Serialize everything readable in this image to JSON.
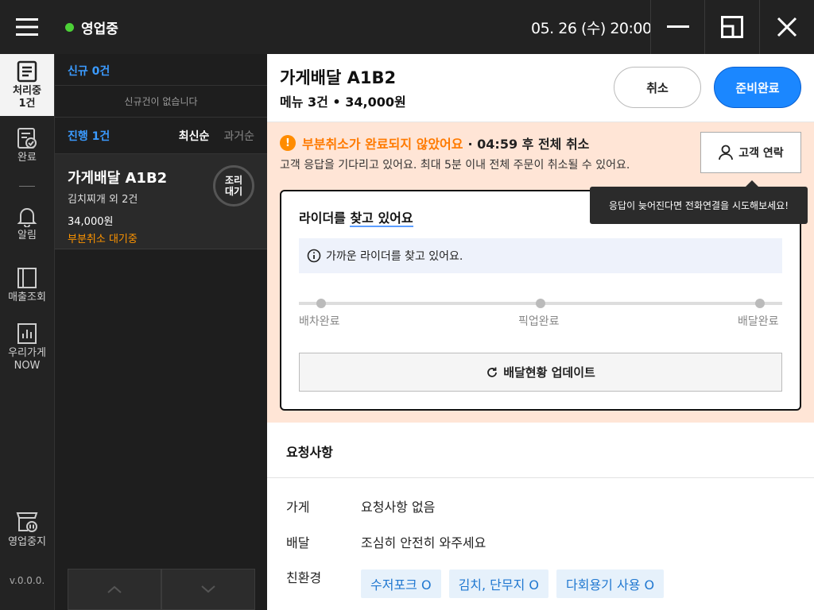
{
  "topbar": {
    "status": "영업중",
    "datetime": "05. 26 (수) 20:00"
  },
  "nav": {
    "items": [
      {
        "label1": "처리중",
        "label2": "1건",
        "icon": "document-icon"
      },
      {
        "label1": "완료",
        "icon": "check-document-icon"
      },
      {
        "label1": "알림",
        "icon": "bell-icon"
      },
      {
        "label1": "매출조회",
        "icon": "book-icon"
      },
      {
        "label1": "우리가게",
        "label2": "NOW",
        "icon": "bar-chart-icon"
      },
      {
        "label1": "영업중지",
        "icon": "store-pause-icon"
      }
    ],
    "version": "v.0.0.0."
  },
  "list": {
    "new_header": "신규 0건",
    "new_empty": "신규건이 없습니다",
    "progress_header": "진행 1건",
    "sort_newest": "최신순",
    "sort_oldest": "과거순",
    "orders": [
      {
        "title": "가게배달 A1B2",
        "items": "김치찌개 외 2건",
        "price": "34,000원",
        "warning": "부분취소 대기중",
        "badge1": "조리",
        "badge2": "대기"
      }
    ]
  },
  "detail": {
    "title": "가게배달 A1B2",
    "subtitle": "메뉴 3건 • 34,000원",
    "cancel_label": "취소",
    "ready_label": "준비완료",
    "alert": {
      "icon": "!",
      "headline": "부분취소가 완료되지 않았어요",
      "countdown": "· 04:59 후 전체 취소",
      "body": "고객 응답을 기다리고 있어요. 최대 5분 이내 전체 주문이 취소될 수 있어요.",
      "contact_label": "고객 연락",
      "tooltip": "응답이 늦어진다면 전화연결을 시도해보세요!"
    },
    "rider": {
      "title_prefix": "라이더를 ",
      "title_underlined": "찾고 있어요",
      "info": "가까운 라이더를 찾고 있어요.",
      "steps": [
        "배차완료",
        "픽업완료",
        "배달완료"
      ],
      "update_label": "배달현황 업데이트"
    },
    "requests": {
      "title": "요청사항",
      "store_label": "가게",
      "store_value": "요청사항 없음",
      "delivery_label": "배달",
      "delivery_value": "조심히 안전히 와주세요",
      "eco_label": "친환경",
      "eco_tags": [
        "수저포크 O",
        "김치, 단무지 O",
        "다회용기 사용 O"
      ]
    }
  }
}
